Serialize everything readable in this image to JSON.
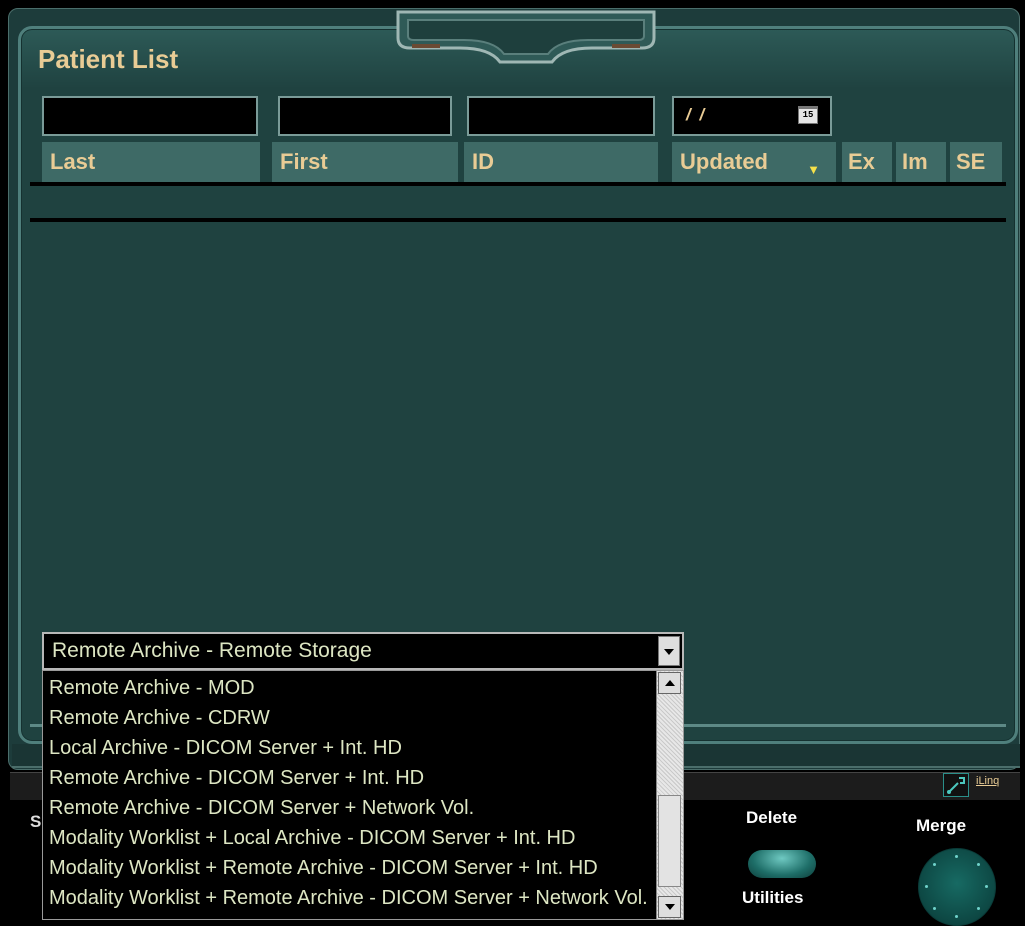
{
  "panel": {
    "title": "Patient List"
  },
  "filters": {
    "last_value": "",
    "first_value": "",
    "id_value": "",
    "date_value": "/ /",
    "calendar_icon_text": "15"
  },
  "columns": {
    "last": "Last",
    "first": "First",
    "id": "ID",
    "updated": "Updated",
    "ex": "Ex",
    "im": "Im",
    "se": "SE"
  },
  "source_dropdown": {
    "selected": "Remote Archive - Remote Storage",
    "options": [
      "Remote Archive - MOD",
      "Remote Archive - CDRW",
      "Local Archive - DICOM Server + Int. HD",
      "Remote Archive - DICOM Server + Int. HD",
      "Remote Archive - DICOM Server + Network Vol.",
      "Modality Worklist + Local Archive - DICOM Server + Int. HD",
      "Modality Worklist + Remote Archive - DICOM Server + Int. HD",
      "Modality Worklist + Remote Archive - DICOM Server + Network Vol."
    ]
  },
  "status_bar": {
    "link_label": "iLinq"
  },
  "buttons": {
    "s_partial": "S",
    "delete": "Delete",
    "utilities": "Utilities",
    "merge": "Merge"
  },
  "icons": {
    "calendar": "calendar-icon",
    "sort": "sort-down-triangle-icon",
    "tool": "wrench-icon",
    "dropdown": "chevron-down-icon"
  },
  "colors": {
    "panel": "#1f4240",
    "header": "#3e6a66",
    "title": "#e9cc95",
    "list_text": "#dde6c3"
  }
}
